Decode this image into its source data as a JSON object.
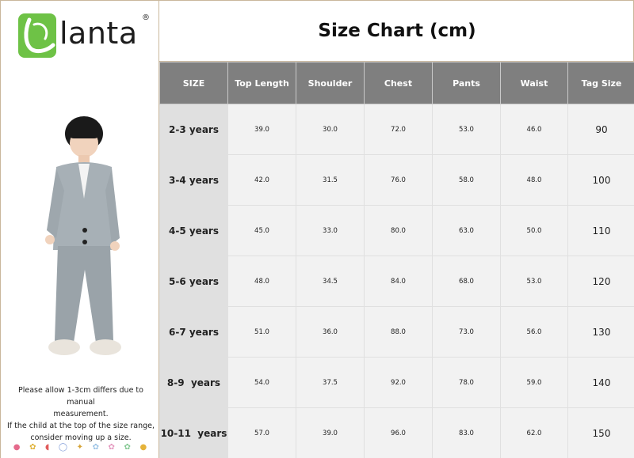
{
  "brand": {
    "name": "lanta",
    "badge_letter": "L",
    "registered": "®"
  },
  "title": "Size Chart (cm)",
  "note": {
    "line1": "Please allow 1-3cm differs due to manual",
    "line2": "measurement.",
    "line3": "If the child at the top of the size range,",
    "line4": "consider moving up a size."
  },
  "colors": {
    "header_bg": "#7f7f7f",
    "size_col_bg": "#e0e0e0",
    "cell_bg": "#f2f2f2",
    "logo_green": "#6ec246"
  },
  "table": {
    "headers": [
      "SIZE",
      "Top Length",
      "Shoulder",
      "Chest",
      "Pants",
      "Waist",
      "Tag Size"
    ],
    "rows": [
      [
        "2-3 years",
        "39.0",
        "30.0",
        "72.0",
        "53.0",
        "46.0",
        "90"
      ],
      [
        "3-4 years",
        "42.0",
        "31.5",
        "76.0",
        "58.0",
        "48.0",
        "100"
      ],
      [
        "4-5 years",
        "45.0",
        "33.0",
        "80.0",
        "63.0",
        "50.0",
        "110"
      ],
      [
        "5-6 years",
        "48.0",
        "34.5",
        "84.0",
        "68.0",
        "53.0",
        "120"
      ],
      [
        "6-7 years",
        "51.0",
        "36.0",
        "88.0",
        "73.0",
        "56.0",
        "130"
      ],
      [
        "8-9  years",
        "54.0",
        "37.5",
        "92.0",
        "78.0",
        "59.0",
        "140"
      ],
      [
        "10-11  years",
        "57.0",
        "39.0",
        "96.0",
        "83.0",
        "62.0",
        "150"
      ]
    ]
  }
}
